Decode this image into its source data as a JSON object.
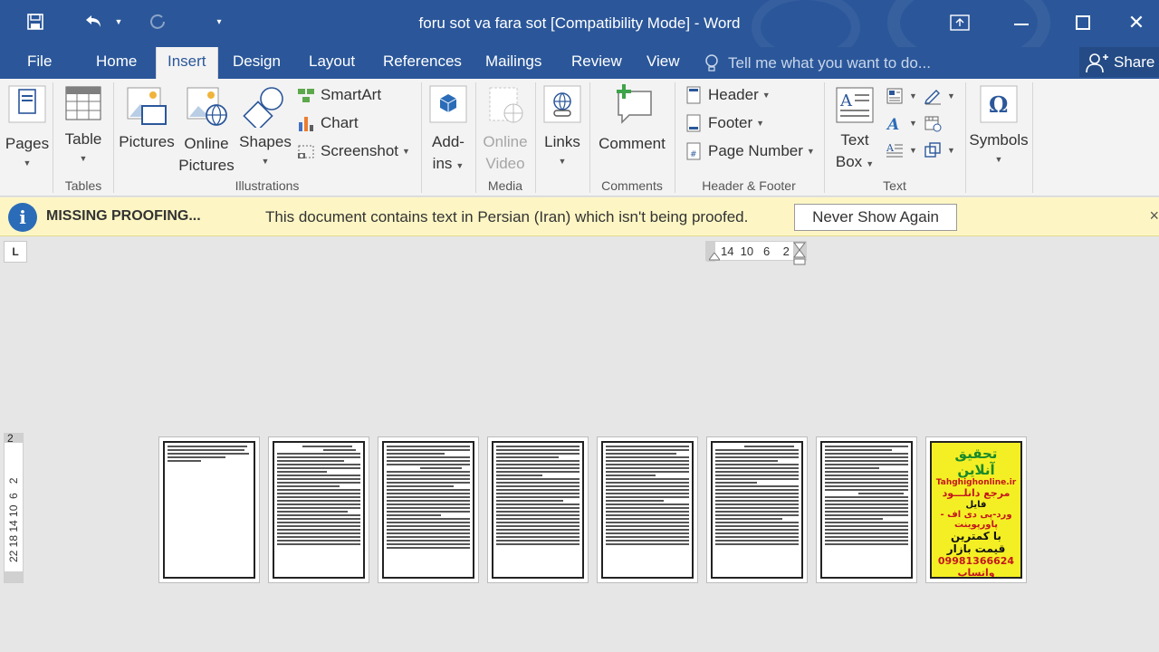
{
  "titlebar": {
    "title": "foru sot va fara sot [Compatibility Mode] - Word",
    "icons": [
      "save-icon",
      "undo-icon",
      "redo-icon",
      "customize-qat-icon",
      "ribbon-display-icon",
      "minimize-icon",
      "maximize-icon",
      "close-icon"
    ]
  },
  "tabs": {
    "items": [
      "File",
      "Home",
      "Insert",
      "Design",
      "Layout",
      "References",
      "Mailings",
      "Review",
      "View"
    ],
    "active": "Insert",
    "tell_me": "Tell me what you want to do...",
    "share": "Share"
  },
  "ribbon": {
    "pages": "Pages",
    "table": "Table",
    "pictures": "Pictures",
    "online_pictures_1": "Online",
    "online_pictures_2": "Pictures",
    "shapes": "Shapes",
    "smartart": "SmartArt",
    "chart": "Chart",
    "screenshot": "Screenshot",
    "addins_1": "Add-",
    "addins_2": "ins",
    "online_video_1": "Online",
    "online_video_2": "Video",
    "links": "Links",
    "comment": "Comment",
    "header": "Header",
    "footer": "Footer",
    "page_number": "Page Number",
    "text_box_1": "Text",
    "text_box_2": "Box",
    "symbols": "Symbols",
    "groups": {
      "tables": "Tables",
      "illustrations": "Illustrations",
      "media": "Media",
      "comments": "Comments",
      "header_footer": "Header & Footer",
      "text": "Text"
    }
  },
  "message_bar": {
    "title": "MISSING PROOFING...",
    "text": "This document contains text in Persian (Iran) which isn't being proofed.",
    "button": "Never Show Again",
    "close": "×"
  },
  "rulers": {
    "horizontal": "14  10   6    2",
    "vertical": "22 18 14 10  6   2",
    "corner": "L",
    "vertical_top": "2"
  },
  "ad_page": {
    "line1": "تحقیق آنلاین",
    "line2": "Tahghighonline.ir",
    "line3": "مرجع دانلـــود",
    "line4": "فایل",
    "line5": "ورد-پی دی اف - پاورپوینت",
    "line6": "با کمترین قیمت بازار",
    "line7": "09981366624 واتساپ"
  }
}
